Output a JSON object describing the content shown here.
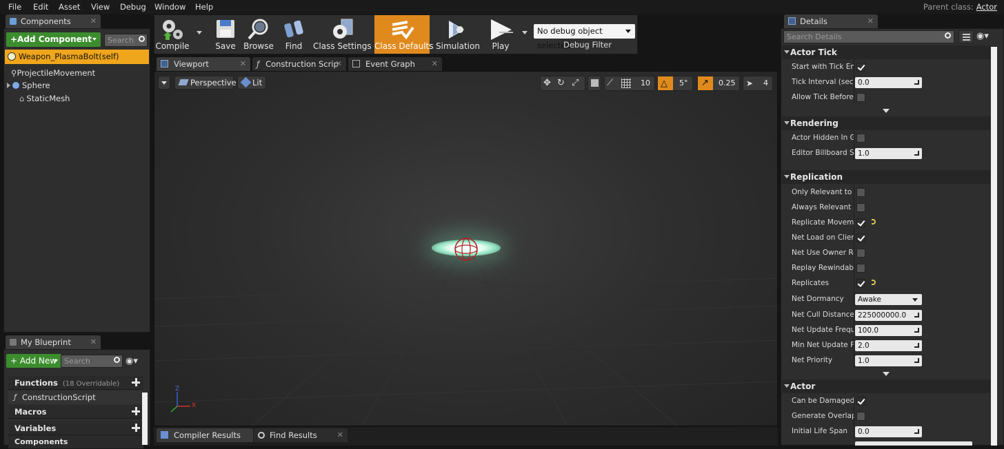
{
  "menu": [
    "File",
    "Edit",
    "Asset",
    "View",
    "Debug",
    "Window",
    "Help"
  ],
  "parent_class": {
    "label": "Parent class:",
    "value": "Actor"
  },
  "components_panel": {
    "tab_label": "Components",
    "add_button": "+Add Component",
    "search_placeholder": "Search",
    "root_item": "Weapon_PlasmaBolt(self)",
    "items": [
      "ProjectileMovement",
      "Sphere",
      "StaticMesh"
    ]
  },
  "my_blueprint": {
    "tab_label": "My Blueprint",
    "add_button": "+ Add New",
    "search_placeholder": "Search",
    "categories": [
      {
        "label": "Functions",
        "extra": "(18 Overridable)"
      },
      {
        "label": "Macros"
      },
      {
        "label": "Variables"
      },
      {
        "label": "Components"
      }
    ],
    "function_item": "ConstructionScript"
  },
  "toolbar": {
    "buttons": [
      {
        "label": "Compile",
        "icon": "compile-gear-icon"
      },
      {
        "label": "Save",
        "icon": "save-disk-icon"
      },
      {
        "label": "Browse",
        "icon": "browse-magnifier-icon"
      },
      {
        "label": "Find",
        "icon": "find-binoculars-icon"
      },
      {
        "label": "Class Settings",
        "icon": "class-settings-gear-icon"
      },
      {
        "label": "Class Defaults",
        "icon": "class-defaults-check-icon"
      },
      {
        "label": "Simulation",
        "icon": "simulation-icon"
      },
      {
        "label": "Play",
        "icon": "play-icon"
      }
    ],
    "debug_select": "No debug object selected",
    "debug_filter_label": "Debug Filter",
    "active_color": "#e08a1e"
  },
  "editor_tabs": [
    "Viewport",
    "Construction Scrip",
    "Event Graph"
  ],
  "viewport": {
    "perspective": "Perspective",
    "lit": "Lit",
    "grid_snap": "10",
    "rotation_snap": "5°",
    "scale_snap": "0.25",
    "camera_speed": "4",
    "axis_labels": {
      "x": "X",
      "z": "Z"
    }
  },
  "bottom_tabs": [
    "Compiler Results",
    "Find Results"
  ],
  "details": {
    "tab_label": "Details",
    "search_placeholder": "Search Details",
    "sections": [
      {
        "title": "Actor Tick",
        "props": [
          {
            "label": "Start with Tick Enab",
            "type": "check",
            "checked": true
          },
          {
            "label": "Tick Interval (secs)",
            "type": "num",
            "value": "0.0"
          },
          {
            "label": "Allow Tick Before B",
            "type": "check",
            "checked": false
          }
        ]
      },
      {
        "title": "Rendering",
        "props": [
          {
            "label": "Actor Hidden In Gar",
            "type": "check",
            "checked": false
          },
          {
            "label": "Editor Billboard Sca",
            "type": "num",
            "value": "1.0"
          }
        ]
      },
      {
        "title": "Replication",
        "props": [
          {
            "label": "Only Relevant to Ov",
            "type": "check",
            "checked": false
          },
          {
            "label": "Always Relevant",
            "type": "check",
            "checked": false
          },
          {
            "label": "Replicate Movemer",
            "type": "check",
            "checked": true
          },
          {
            "label": "Net Load on Client",
            "type": "check",
            "checked": true
          },
          {
            "label": "Net Use Owner Rele",
            "type": "check",
            "checked": false
          },
          {
            "label": "Replay Rewindable",
            "type": "check",
            "checked": false
          },
          {
            "label": "Replicates",
            "type": "check",
            "checked": true
          },
          {
            "label": "Net Dormancy",
            "type": "combo",
            "value": "Awake"
          },
          {
            "label": "Net Cull Distance S",
            "type": "num",
            "value": "225000000.0"
          },
          {
            "label": "Net Update Frequer",
            "type": "num",
            "value": "100.0"
          },
          {
            "label": "Min Net Update Fre",
            "type": "num",
            "value": "2.0"
          },
          {
            "label": "Net Priority",
            "type": "num",
            "value": "1.0"
          }
        ]
      },
      {
        "title": "Actor",
        "props": [
          {
            "label": "Can be Damaged",
            "type": "check",
            "checked": true
          },
          {
            "label": "Generate Overlap E",
            "type": "check",
            "checked": false
          },
          {
            "label": "Initial Life Span",
            "type": "num",
            "value": "0.0"
          }
        ]
      }
    ]
  }
}
